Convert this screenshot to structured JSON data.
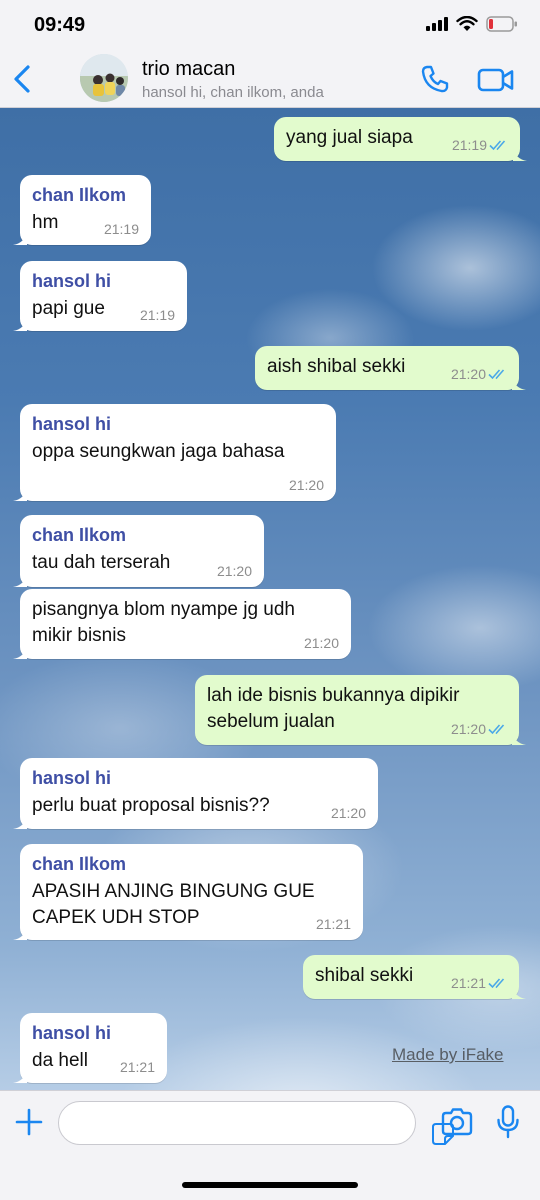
{
  "status_bar": {
    "time": "09:49"
  },
  "header": {
    "title": "trio macan",
    "subtitle": "hansol hi, chan ilkom, anda"
  },
  "colors": {
    "accent": "#1a86f0",
    "outgoing_bubble": "#e2fbcd",
    "incoming_bubble": "#ffffff",
    "sender_name": "#3f4fa5",
    "read_tick": "#4aa8e8"
  },
  "messages": [
    {
      "dir": "out",
      "text": "yang jual siapa",
      "time": "21:19",
      "read": true
    },
    {
      "dir": "in",
      "sender": "chan Ilkom",
      "text": "hm",
      "time": "21:19"
    },
    {
      "dir": "in",
      "sender": "hansol hi",
      "text": "papi gue",
      "time": "21:19"
    },
    {
      "dir": "out",
      "text": "aish shibal sekki",
      "time": "21:20",
      "read": true
    },
    {
      "dir": "in",
      "sender": "hansol hi",
      "text": "oppa seungkwan jaga bahasa",
      "time": "21:20"
    },
    {
      "dir": "in",
      "sender": "chan Ilkom",
      "text": "tau dah terserah",
      "time": "21:20"
    },
    {
      "dir": "in",
      "text": "pisangnya blom nyampe jg udh\nmikir bisnis",
      "time": "21:20"
    },
    {
      "dir": "out",
      "text": "lah ide bisnis bukannya dipikir\nsebelum jualan",
      "time": "21:20",
      "read": true
    },
    {
      "dir": "in",
      "sender": "hansol hi",
      "text": "perlu buat proposal bisnis??",
      "time": "21:20"
    },
    {
      "dir": "in",
      "sender": "chan Ilkom",
      "text": "APASIH ANJING BINGUNG GUE\nCAPEK UDH STOP",
      "time": "21:21"
    },
    {
      "dir": "out",
      "text": "shibal sekki",
      "time": "21:21",
      "read": true
    },
    {
      "dir": "in",
      "sender": "hansol hi",
      "text": "da hell",
      "time": "21:21"
    }
  ],
  "watermark": "Made by iFake",
  "input": {
    "placeholder": ""
  }
}
